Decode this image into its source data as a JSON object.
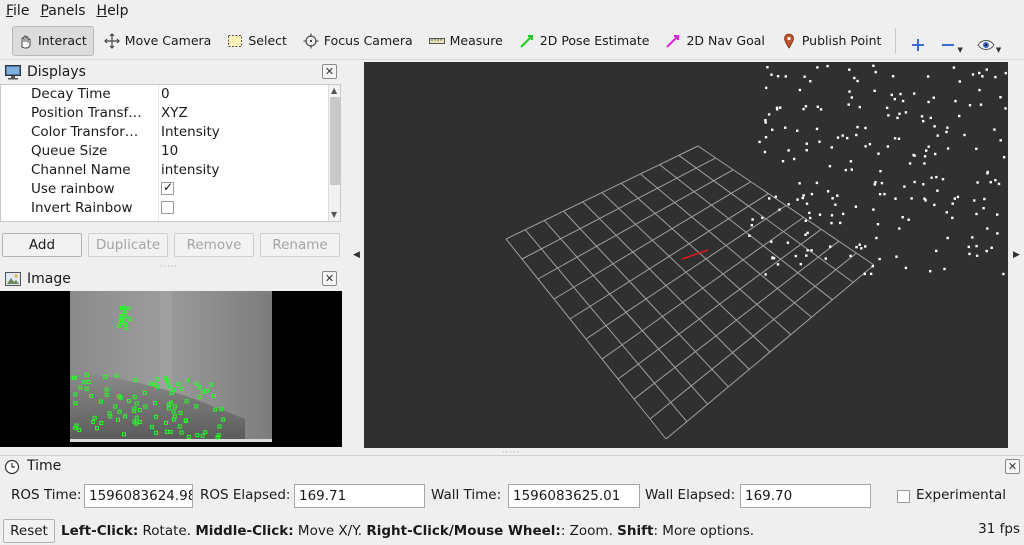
{
  "menubar": {
    "items": [
      {
        "label": "File",
        "mnemonic": "F",
        "rest": "ile"
      },
      {
        "label": "Panels",
        "mnemonic": "P",
        "rest": "anels"
      },
      {
        "label": "Help",
        "mnemonic": "H",
        "rest": "elp"
      }
    ]
  },
  "toolbar": {
    "tools": [
      {
        "label": "Interact",
        "icon": "cursor-icon",
        "active": true
      },
      {
        "label": "Move Camera",
        "icon": "move-camera-icon"
      },
      {
        "label": "Select",
        "icon": "select-rect-icon"
      },
      {
        "label": "Focus Camera",
        "icon": "focus-camera-icon"
      },
      {
        "label": "Measure",
        "icon": "ruler-icon"
      },
      {
        "label": "2D Pose Estimate",
        "icon": "pose-arrow-icon",
        "color": "#22cc22"
      },
      {
        "label": "2D Nav Goal",
        "icon": "nav-goal-arrow-icon",
        "color": "#e020e0"
      },
      {
        "label": "Publish Point",
        "icon": "map-pin-icon",
        "color": "#c0502a"
      }
    ]
  },
  "displays": {
    "title": "Displays",
    "properties": [
      {
        "key": "Decay Time",
        "value": "0"
      },
      {
        "key": "Position Transf…",
        "value": "XYZ"
      },
      {
        "key": "Color Transfor…",
        "value": "Intensity"
      },
      {
        "key": "Queue Size",
        "value": "10"
      },
      {
        "key": "Channel Name",
        "value": "intensity"
      },
      {
        "key": "Use rainbow",
        "checked": true
      },
      {
        "key": "Invert Rainbow",
        "checked": false
      }
    ],
    "buttons": {
      "add": "Add",
      "duplicate": "Duplicate",
      "remove": "Remove",
      "rename": "Rename"
    }
  },
  "image_panel": {
    "title": "Image"
  },
  "time_panel": {
    "title": "Time",
    "ros_time_label": "ROS Time:",
    "ros_time_value": "1596083624.98",
    "ros_elapsed_label": "ROS Elapsed:",
    "ros_elapsed_value": "169.71",
    "wall_time_label": "Wall Time:",
    "wall_time_value": "1596083625.01",
    "wall_elapsed_label": "Wall Elapsed:",
    "wall_elapsed_value": "169.70",
    "experimental_label": "Experimental"
  },
  "status": {
    "reset_label": "Reset",
    "hint_parts": [
      {
        "b": "Left-Click:",
        "t": " Rotate. "
      },
      {
        "b": "Middle-Click:",
        "t": " Move X/Y. "
      },
      {
        "b": "Right-Click/Mouse Wheel:",
        "t": ": Zoom. "
      },
      {
        "b": "Shift",
        "t": ": More options."
      }
    ],
    "fps": "31 fps"
  },
  "colors": {
    "view_background": "#303030",
    "grid": "#a0a0a0",
    "points": "#ffffff",
    "feature_points": "#22ff22",
    "axis_marker": "#e01818"
  }
}
